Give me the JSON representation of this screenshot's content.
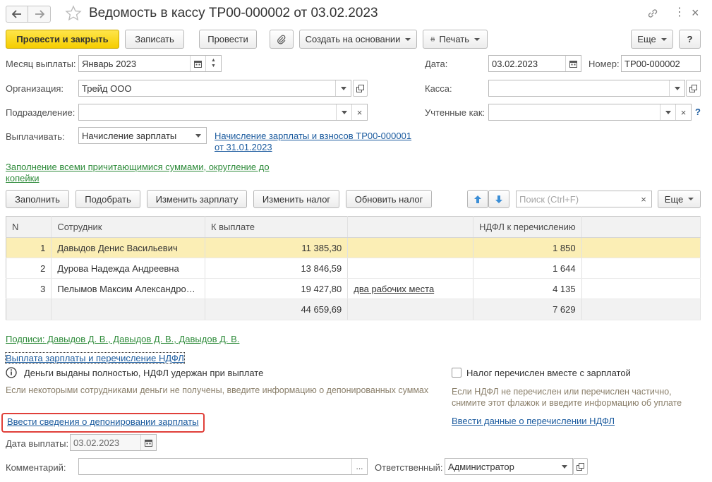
{
  "window": {
    "title": "Ведомость в кассу ТР00-000002 от 03.02.2023"
  },
  "toolbar": {
    "post_close": "Провести и закрыть",
    "save": "Записать",
    "post": "Провести",
    "create_based": "Создать на основании",
    "print": "Печать",
    "more": "Еще",
    "help": "?"
  },
  "form": {
    "month_label": "Месяц выплаты:",
    "month_value": "Январь 2023",
    "date_label": "Дата:",
    "date_value": "03.02.2023",
    "number_label": "Номер:",
    "number_value": "ТР00-000002",
    "org_label": "Организация:",
    "org_value": "Трейд ООО",
    "cash_label": "Касса:",
    "cash_value": "",
    "dept_label": "Подразделение:",
    "dept_value": "",
    "accounted_label": "Учтенные как:",
    "accounted_value": "",
    "accounted_help": "?",
    "pay_label": "Выплачивать:",
    "pay_value": "Начисление зарплаты",
    "accrual_link_1": "Начисление зарплаты и взносов ТР00-000001",
    "accrual_link_2": "от 31.01.2023",
    "fill_link_1": "Заполнение всеми причитающимися суммами, округление до",
    "fill_link_2": "копейки"
  },
  "table_toolbar": {
    "fill": "Заполнить",
    "pick": "Подобрать",
    "change_salary": "Изменить зарплату",
    "change_tax": "Изменить налог",
    "update_tax": "Обновить налог",
    "search_placeholder": "Поиск (Ctrl+F)",
    "more": "Еще"
  },
  "table": {
    "headers": [
      "N",
      "Сотрудник",
      "К выплате",
      "",
      "НДФЛ к перечислению"
    ],
    "rows": [
      {
        "n": "1",
        "employee": "Давыдов Денис Васильевич",
        "amount": "11 385,30",
        "note": "",
        "tax": "1 850"
      },
      {
        "n": "2",
        "employee": "Дурова Надежда Андреевна",
        "amount": "13 846,59",
        "note": "",
        "tax": "1 644"
      },
      {
        "n": "3",
        "employee": "Пелымов Максим Александро…",
        "amount": "19 427,80",
        "note": "два рабочих места",
        "tax": "4 135"
      }
    ],
    "totals": {
      "amount": "44 659,69",
      "tax": "7 629"
    }
  },
  "bottom": {
    "signatures_link": "Подписи: Давыдов Д. В., Давыдов Д. В., Давыдов Д. В.",
    "payment_link": "Выплата зарплаты и перечисление НДФЛ",
    "info_text": "Деньги выданы полностью, НДФЛ удержан при выплате",
    "deposit_hint": "Если некоторыми сотрудниками деньги не получены, введите информацию о депонированных суммах",
    "deposit_link": "Ввести сведения о депонировании зарплаты",
    "tax_checkbox_label": "Налог перечислен вместе с зарплатой",
    "tax_hint_1": "Если НДФЛ не перечислен или перечислен частично,",
    "tax_hint_2": "снимите этот флажок и введите информацию об уплате",
    "tax_link": "Ввести данные о перечислении НДФЛ",
    "pay_date_label": "Дата выплаты:",
    "pay_date_value": "03.02.2023",
    "comment_label": "Комментарий:",
    "comment_value": "",
    "responsible_label": "Ответственный:",
    "responsible_value": "Администратор"
  },
  "colors": {
    "accent_yellow": "#f5cd00",
    "link_blue": "#1a5a9e",
    "link_green": "#2e8b3a",
    "highlight_red": "#e0403a",
    "selected_row": "#fbeeb5"
  }
}
